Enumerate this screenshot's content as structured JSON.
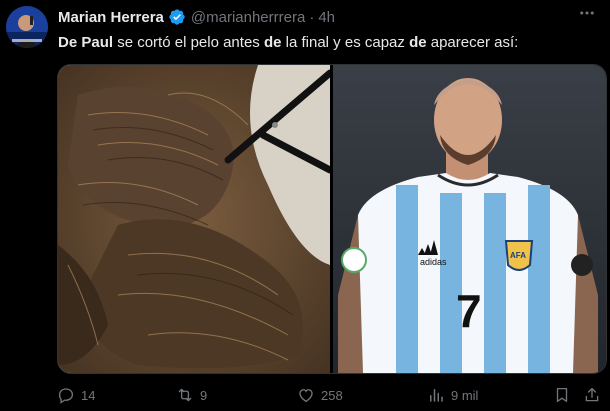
{
  "tweet": {
    "author_name": "Marian Herrera",
    "handle": "@marianherrrera",
    "separator": "·",
    "time": "4h",
    "text_parts": [
      {
        "t": "De Paul",
        "bold": true
      },
      {
        "t": " se cortó el pelo antes ",
        "bold": false
      },
      {
        "t": "de",
        "bold": true
      },
      {
        "t": " la final y es capaz ",
        "bold": false
      },
      {
        "t": "de",
        "bold": true
      },
      {
        "t": " aparecer así:",
        "bold": false
      }
    ],
    "jersey_number": "7",
    "jersey_brand": "adidas",
    "jersey_badge": "AFA"
  },
  "actions": {
    "replies": "14",
    "retweets": "9",
    "likes": "258",
    "views": "9 mil"
  },
  "icons": {
    "verified": "verified-badge-icon",
    "more": "more-icon",
    "reply": "reply-icon",
    "retweet": "retweet-icon",
    "like": "heart-icon",
    "views": "views-icon",
    "bookmark": "bookmark-icon",
    "share": "share-icon"
  },
  "colors": {
    "background": "#000000",
    "text": "#e7e9ea",
    "muted": "#71767b",
    "verified": "#1d9bf0"
  }
}
